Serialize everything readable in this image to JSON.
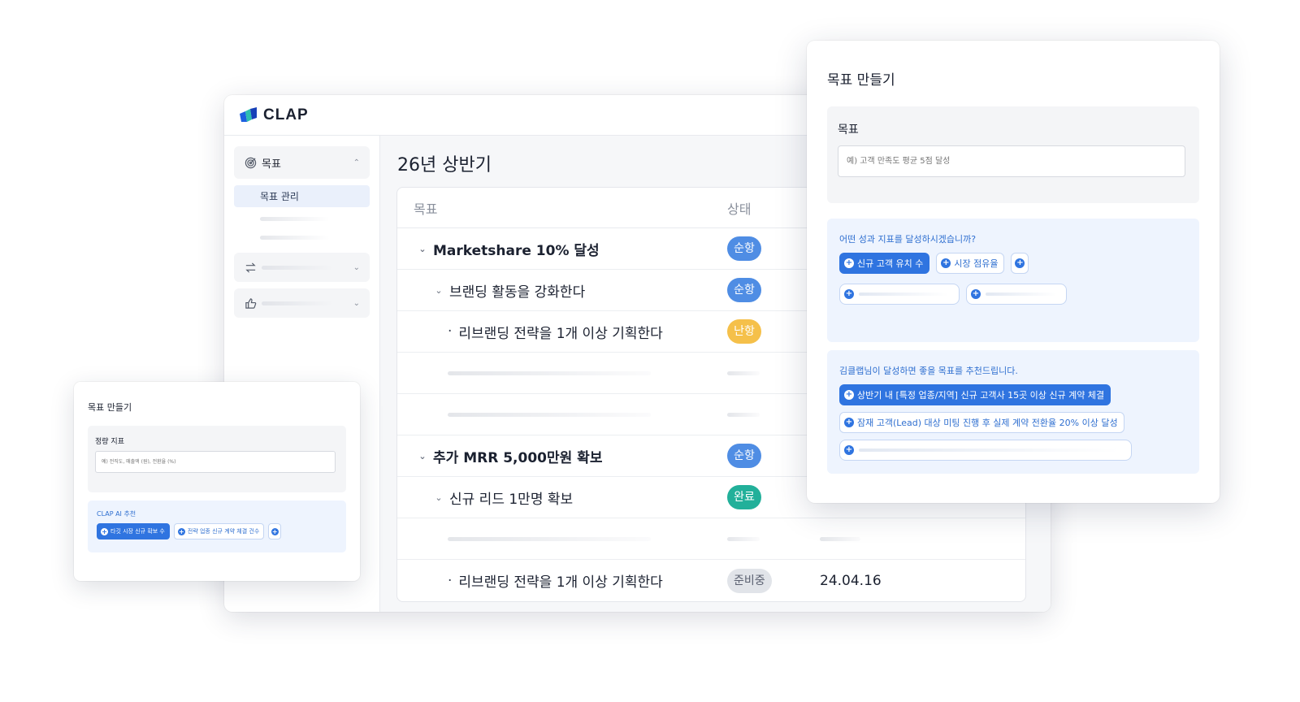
{
  "app": {
    "logo_text": "CLAP",
    "period_title": "26년 상반기"
  },
  "sidebar": {
    "group1_label": "목표",
    "group1_sub_label": "목표 관리"
  },
  "table": {
    "col_goal": "목표",
    "col_status": "상태",
    "rows": [
      {
        "level": 0,
        "title": "Marketshare 10% 달성",
        "status": "순항"
      },
      {
        "level": 1,
        "title": "브랜딩 활동을 강화한다",
        "status": "순항"
      },
      {
        "level": 2,
        "title": "리브랜딩 전략을 1개 이상 기획한다",
        "status": "난항"
      },
      {
        "level": 0,
        "title": "추가 MRR 5,000만원 확보",
        "status": "순항"
      },
      {
        "level": 1,
        "title": "신규 리드 1만명 확보",
        "status": "완료"
      },
      {
        "level": 2,
        "title": "리브랜딩 전략을 1개 이상 기획한다",
        "status": "준비중",
        "date": "24.04.16"
      }
    ]
  },
  "modal_right": {
    "title": "목표 만들기",
    "goal_label": "목표",
    "goal_placeholder": "예) 고객 만족도 평균 5점 달성",
    "metric_question": "어떤 성과 지표를 달성하시겠습니까?",
    "metric_chips": [
      "신규 고객 유치 수",
      "시장 점유율"
    ],
    "recommend_title": "김클랩님이 달성하면 좋을 목표를 추천드립니다.",
    "recommendations": [
      "상반기 내 [특정 업종/지역] 신규 고객사 15곳 이상 신규 계약 체결",
      "잠재 고객(Lead) 대상 미팅 진행 후 실제 계약 전환율 20% 이상 달성"
    ]
  },
  "modal_left": {
    "title": "목표 만들기",
    "metric_label": "정량 지표",
    "metric_placeholder": "예) 전직도, 매출액 (원), 전환율 (%)",
    "ai_label": "CLAP AI 추천",
    "ai_chips": [
      "타깃 시장 신규 확보 수",
      "전략 업종 신규 계약 체결 건수"
    ]
  },
  "colors": {
    "accent_blue": "#2f74e0",
    "status_on_track": "#4f8de4",
    "status_difficult": "#f5c04a",
    "status_done": "#22b09a",
    "status_preparing": "#e1e4e9"
  },
  "icons": [
    "clap-logo-icon",
    "target-icon",
    "chevron-up-icon",
    "chevron-down-icon",
    "exchange-icon",
    "thumbs-up-icon",
    "plus-circle-icon"
  ]
}
